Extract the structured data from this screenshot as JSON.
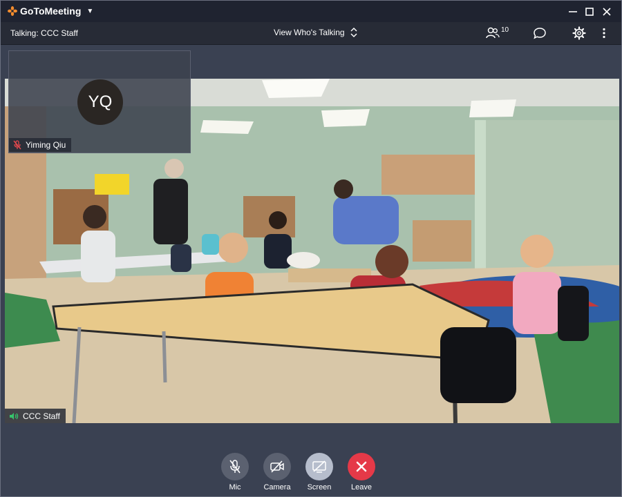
{
  "app": {
    "name": "GoToMeeting",
    "brand_color": "#f68d2e"
  },
  "toolbar": {
    "talking": "Talking: CCC Staff",
    "view_label": "View Who's Talking",
    "attendee_count": "10"
  },
  "main_video": {
    "speaker_label": "CCC Staff"
  },
  "thumbnail": {
    "initials": "YQ",
    "name": "Yiming Qiu"
  },
  "controls": {
    "mic_label": "Mic",
    "camera_label": "Camera",
    "screen_label": "Screen",
    "leave_label": "Leave",
    "leave_color": "#e53948"
  }
}
